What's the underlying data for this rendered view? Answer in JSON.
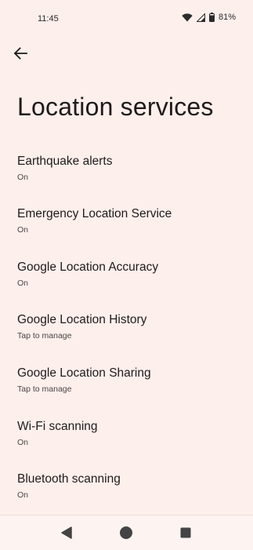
{
  "status_bar": {
    "time": "11:45",
    "battery": "81%",
    "icons": [
      "wifi-icon",
      "cellular-signal-icon",
      "battery-icon"
    ]
  },
  "header": {
    "back_icon": "arrow-back-icon",
    "title": "Location services"
  },
  "items": [
    {
      "title": "Earthquake alerts",
      "subtitle": "On"
    },
    {
      "title": "Emergency Location Service",
      "subtitle": "On"
    },
    {
      "title": "Google Location Accuracy",
      "subtitle": "On"
    },
    {
      "title": "Google Location History",
      "subtitle": "Tap to manage"
    },
    {
      "title": "Google Location Sharing",
      "subtitle": "Tap to manage"
    },
    {
      "title": "Wi-Fi scanning",
      "subtitle": "On"
    },
    {
      "title": "Bluetooth scanning",
      "subtitle": "On"
    }
  ],
  "nav_bar": {
    "icons": [
      "back-triangle-icon",
      "home-circle-icon",
      "recents-square-icon"
    ]
  },
  "colors": {
    "background": "#fcefec",
    "text_primary": "#1d1b1b",
    "text_secondary": "#4d4546"
  }
}
